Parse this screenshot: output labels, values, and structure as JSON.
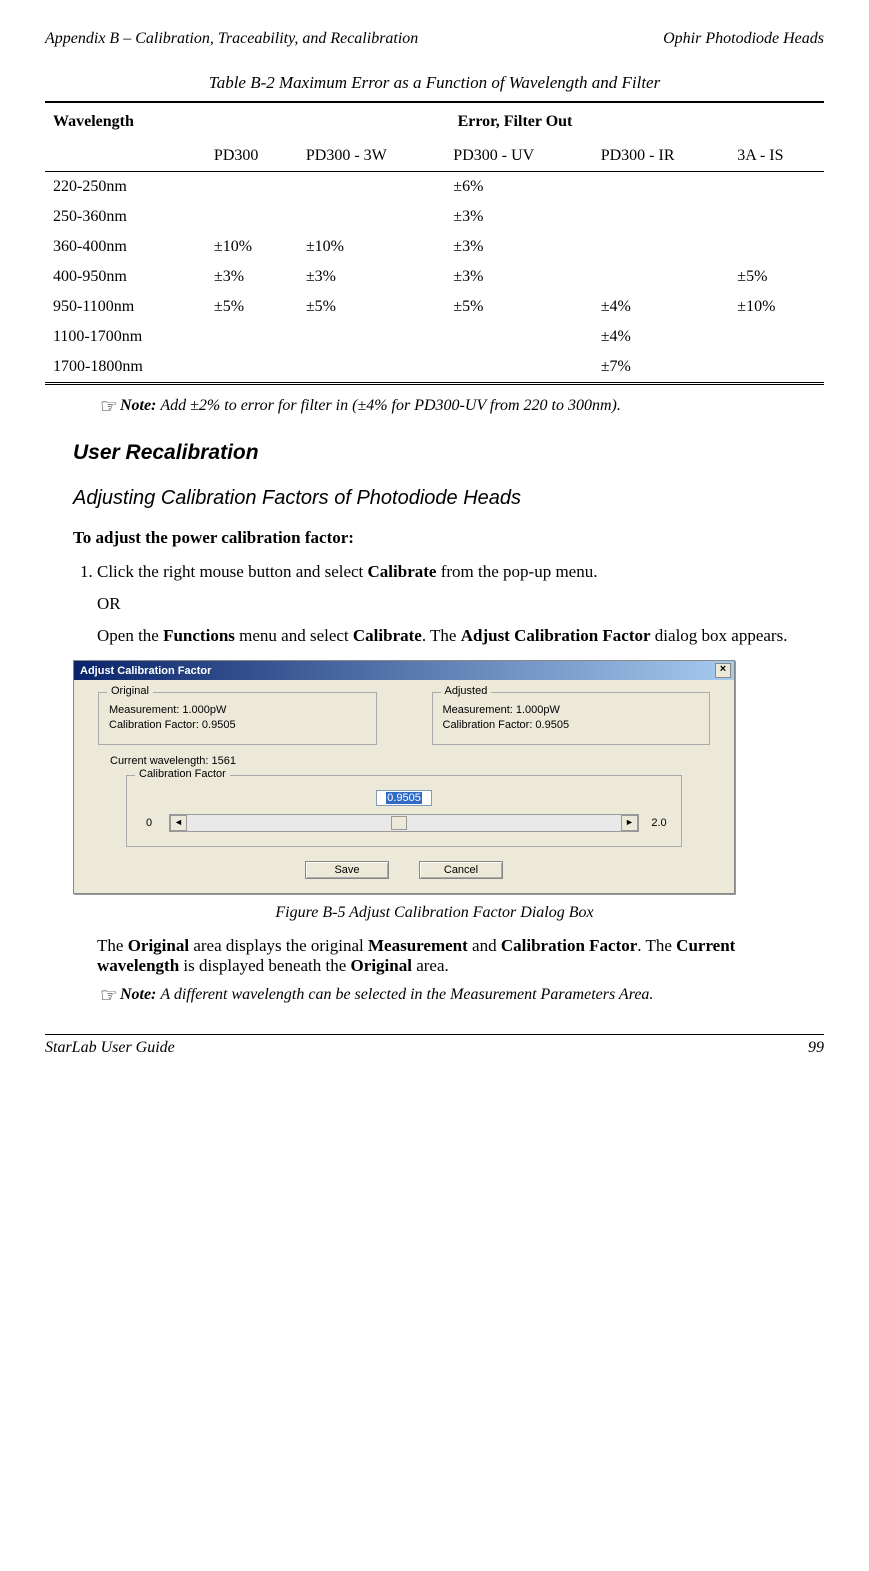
{
  "header": {
    "left": "Appendix B – Calibration, Traceability, and Recalibration",
    "right": "Ophir Photodiode Heads"
  },
  "table": {
    "title": "Table B-2 Maximum Error as a Function of Wavelength and Filter",
    "header": {
      "col1": "Wavelength",
      "span": "Error, Filter Out"
    },
    "cols": [
      "PD300",
      "PD300 - 3W",
      "PD300 - UV",
      "PD300 - IR",
      "3A - IS"
    ],
    "rows": [
      {
        "wl": "220-250nm",
        "c": [
          "",
          "",
          "±6%",
          "",
          ""
        ]
      },
      {
        "wl": "250-360nm",
        "c": [
          "",
          "",
          "±3%",
          "",
          ""
        ]
      },
      {
        "wl": "360-400nm",
        "c": [
          "±10%",
          "±10%",
          "±3%",
          "",
          ""
        ]
      },
      {
        "wl": "400-950nm",
        "c": [
          "±3%",
          "±3%",
          "±3%",
          "",
          "±5%"
        ]
      },
      {
        "wl": "950-1100nm",
        "c": [
          "±5%",
          "±5%",
          "±5%",
          "±4%",
          "±10%"
        ]
      },
      {
        "wl": "1100-1700nm",
        "c": [
          "",
          "",
          "",
          "±4%",
          ""
        ]
      },
      {
        "wl": "1700-1800nm",
        "c": [
          "",
          "",
          "",
          "±7%",
          ""
        ]
      }
    ]
  },
  "note1": {
    "icon": "☞",
    "label": "Note:",
    "text": "Add ±2% to error for filter in (±4% for PD300-UV from 220 to 300nm)."
  },
  "section": "User Recalibration",
  "subsection": "Adjusting Calibration Factors of Photodiode Heads",
  "boldline": "To adjust the power calibration factor:",
  "step1_prefix": "Click the right mouse button and select ",
  "step1_b1": "Calibrate",
  "step1_suffix": " from the pop-up menu.",
  "or": "OR",
  "open_prefix": "Open the ",
  "open_b1": "Functions",
  "open_mid1": " menu and select ",
  "open_b2": "Calibrate",
  "open_mid2": ". The ",
  "open_b3": "Adjust Calibration Factor",
  "open_suffix": " dialog box appears.",
  "dialog": {
    "title": "Adjust Calibration Factor",
    "original": {
      "legend": "Original",
      "l1": "Measurement: 1.000pW",
      "l2": "Calibration Factor: 0.9505"
    },
    "adjusted": {
      "legend": "Adjusted",
      "l1": "Measurement: 1.000pW",
      "l2": "Calibration Factor: 0.9505"
    },
    "current_wl": "Current wavelength: 1561",
    "calfactor_legend": "Calibration Factor",
    "value": "0.9505",
    "min": "0",
    "max": "2.0",
    "save": "Save",
    "cancel": "Cancel"
  },
  "figure_caption": "Figure B-5 Adjust Calibration Factor Dialog Box",
  "para_prefix": "The ",
  "para_b1": "Original",
  "para_mid1": " area displays the original ",
  "para_b2": "Measurement",
  "para_mid2": " and ",
  "para_b3": "Calibration Factor",
  "para_mid3": ". The ",
  "para_b4": "Current wavelength",
  "para_mid4": " is displayed beneath the ",
  "para_b5": "Original",
  "para_suffix": " area.",
  "note2": {
    "icon": "☞",
    "label": "Note:",
    "text": "A different wavelength can be selected in the Measurement Parameters Area."
  },
  "footer": {
    "left": "StarLab User Guide",
    "right": "99"
  }
}
